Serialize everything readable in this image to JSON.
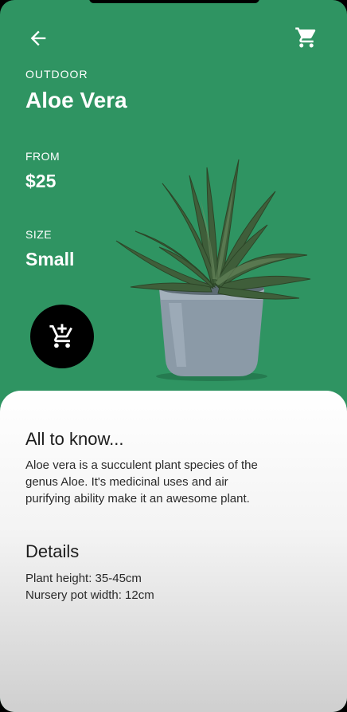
{
  "header": {
    "back_icon": "arrow-left-icon",
    "cart_icon": "shopping-cart-icon"
  },
  "plant": {
    "category": "OUTDOOR",
    "name": "Aloe Vera",
    "price_label": "FROM",
    "price": "$25",
    "size_label": "SIZE",
    "size": "Small",
    "add_to_cart_icon": "add-to-cart-icon"
  },
  "about": {
    "title": "All to know...",
    "line1": "Aloe vera is a succulent plant species of the",
    "line2": "genus Aloe. It's medicinal uses and air",
    "line3": "purifying ability make it an awesome plant."
  },
  "details": {
    "title": "Details",
    "height": "Plant height: 35-45cm",
    "pot_width": "Nursery pot width: 12cm"
  },
  "colors": {
    "primary": "#2f9462",
    "pot": "#8b9aa7",
    "button": "#000000"
  }
}
